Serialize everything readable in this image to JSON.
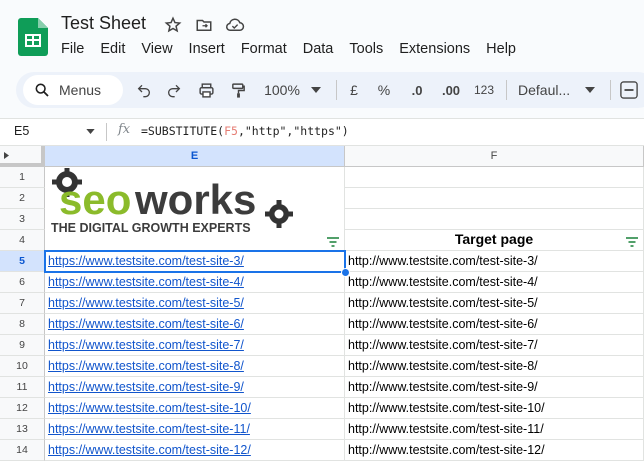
{
  "app": {
    "title": "Test Sheet",
    "brand_color": "#0f9d58"
  },
  "menubar": [
    "File",
    "Edit",
    "View",
    "Insert",
    "Format",
    "Data",
    "Tools",
    "Extensions",
    "Help"
  ],
  "toolbar": {
    "menus_label": "Menus",
    "zoom": "100%",
    "currency": "£",
    "percent": "%",
    "dec_decrease": ".0",
    "dec_increase": ".00",
    "number_format": "123",
    "font": "Defaul..."
  },
  "formula_bar": {
    "cell_ref": "E5",
    "fx": "fx",
    "formula_prefix": "=SUBSTITUTE(",
    "formula_ref": "F5",
    "formula_suffix": ",\"http\",\"https\")"
  },
  "columns": [
    "E",
    "F"
  ],
  "rows": [
    "1",
    "2",
    "3",
    "4",
    "5",
    "6",
    "7",
    "8",
    "9",
    "10",
    "11",
    "12",
    "13",
    "14"
  ],
  "logo": {
    "word_seo": "seo",
    "word_works": "works",
    "tagline": "THE DIGITAL GROWTH EXPERTS"
  },
  "header_row": {
    "E": "",
    "F": "Target page"
  },
  "data_rows": [
    {
      "E": "https://www.testsite.com/test-site-3/",
      "F": "http://www.testsite.com/test-site-3/"
    },
    {
      "E": "https://www.testsite.com/test-site-4/",
      "F": "http://www.testsite.com/test-site-4/"
    },
    {
      "E": "https://www.testsite.com/test-site-5/",
      "F": "http://www.testsite.com/test-site-5/"
    },
    {
      "E": "https://www.testsite.com/test-site-6/",
      "F": "http://www.testsite.com/test-site-6/"
    },
    {
      "E": "https://www.testsite.com/test-site-7/",
      "F": "http://www.testsite.com/test-site-7/"
    },
    {
      "E": "https://www.testsite.com/test-site-8/",
      "F": "http://www.testsite.com/test-site-8/"
    },
    {
      "E": "https://www.testsite.com/test-site-9/",
      "F": "http://www.testsite.com/test-site-9/"
    },
    {
      "E": "https://www.testsite.com/test-site-10/",
      "F": "http://www.testsite.com/test-site-10/"
    },
    {
      "E": "https://www.testsite.com/test-site-11/",
      "F": "http://www.testsite.com/test-site-11/"
    },
    {
      "E": "https://www.testsite.com/test-site-12/",
      "F": "http://www.testsite.com/test-site-12/"
    }
  ],
  "selected_cell": "E5"
}
